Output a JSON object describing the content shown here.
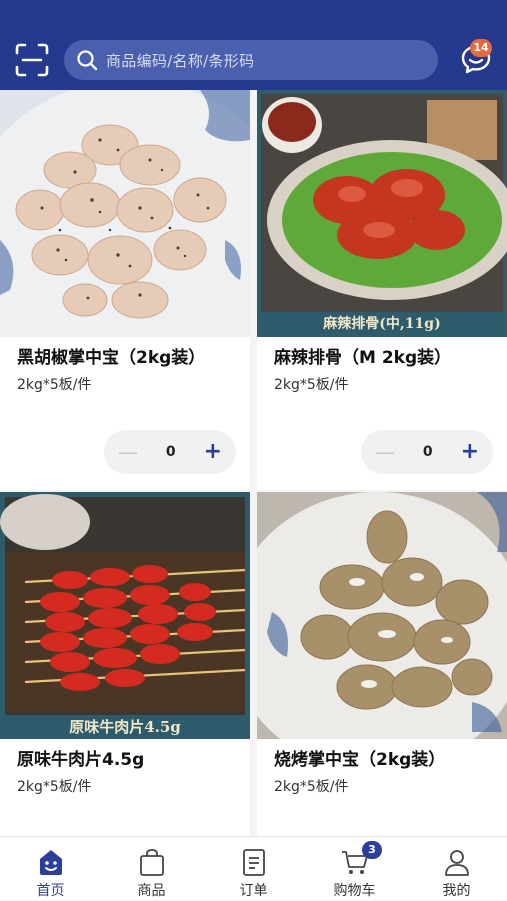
{
  "search": {
    "placeholder": "商品编码/名称/条形码"
  },
  "messages": {
    "badge": "14"
  },
  "products": [
    {
      "name": "黑胡椒掌中宝（2kg装）",
      "spec": "2kg*5板/件",
      "qty": "0",
      "banner": ""
    },
    {
      "name": "麻辣排骨（M 2kg装）",
      "spec": "2kg*5板/件",
      "qty": "0",
      "banner": "麻辣排骨(中,11g)"
    },
    {
      "name": "原味牛肉片4.5g",
      "spec": "2kg*5板/件",
      "banner": "原味牛肉片4.5g"
    },
    {
      "name": "烧烤掌中宝（2kg装）",
      "spec": "2kg*5板/件",
      "banner": ""
    }
  ],
  "tabs": [
    {
      "label": "首页",
      "icon": "home-icon",
      "active": true
    },
    {
      "label": "商品",
      "icon": "bag-icon"
    },
    {
      "label": "订单",
      "icon": "order-icon"
    },
    {
      "label": "购物车",
      "icon": "cart-icon",
      "badge": "3"
    },
    {
      "label": "我的",
      "icon": "user-icon"
    }
  ],
  "colors": {
    "header": "#253a8f",
    "accent": "#2b3f99",
    "badge": "#e56b3d"
  }
}
